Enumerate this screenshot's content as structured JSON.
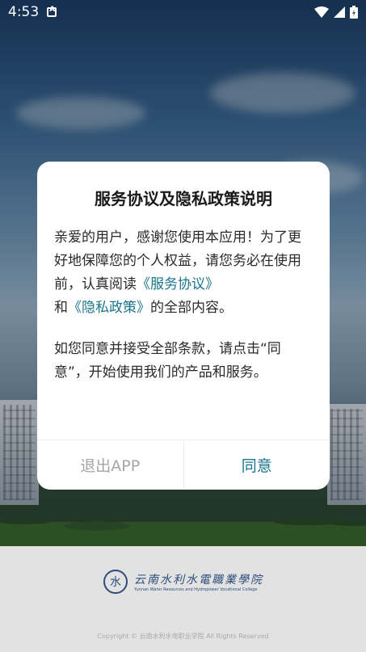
{
  "status_bar": {
    "time": "4:53"
  },
  "dialog": {
    "title": "服务协议及隐私政策说明",
    "para1": {
      "text_a": "亲爱的用户，感谢您使用本应用！为了更好地保障您的个人权益，请您务必在使用前，认真阅读",
      "link_service": "《服务协议》",
      "text_b": "和",
      "link_privacy": "《隐私政策》",
      "text_c": "的全部内容。"
    },
    "para2": "如您同意并接受全部条款，请点击“同意”，开始使用我们的产品和服务。",
    "exit_label": "退出APP",
    "agree_label": "同意"
  },
  "footer": {
    "logo_cn": "云南水利水電職業學院",
    "logo_en": "Yunnan Water Resources and Hydropower Vocational College",
    "copyright": "Copyright © 云南水利水电职业学院 All Rights Reserved"
  },
  "colors": {
    "accent": "#19748c",
    "muted": "#a5a5a5"
  }
}
